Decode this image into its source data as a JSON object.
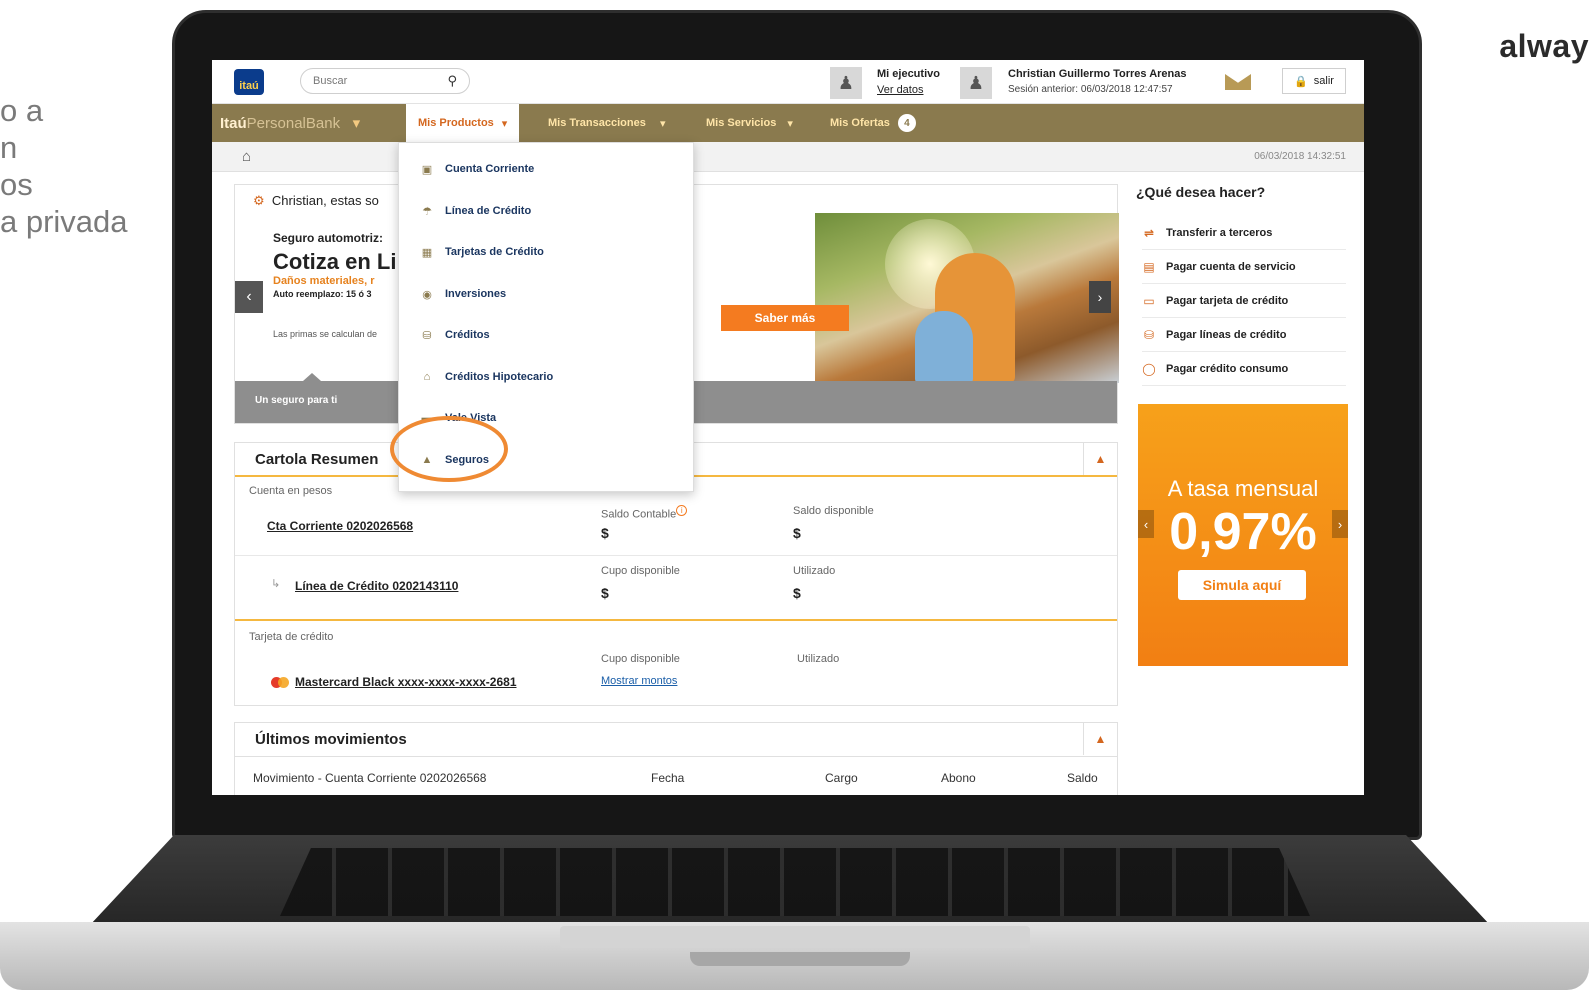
{
  "side_text": [
    "o a",
    "n",
    "os",
    "a privada"
  ],
  "brand_word": "alway",
  "topbar": {
    "logo": "itaú",
    "search_placeholder": "Buscar",
    "executive_label": "Mi ejecutivo",
    "executive_link": "Ver datos",
    "user_name": "Christian Guillermo Torres Arenas",
    "previous_session": "Sesión anterior: 06/03/2018 12:47:57",
    "logout_label": "salir"
  },
  "navbar": {
    "brand_bold": "Itaú",
    "brand_light": "PersonalBank",
    "items": {
      "productos": "Mis Productos",
      "transacciones": "Mis Transacciones",
      "servicios": "Mis Servicios",
      "ofertas": "Mis Ofertas",
      "ofertas_badge": "4"
    }
  },
  "breadcrumb": {
    "datetime": "06/03/2018 14:32:51"
  },
  "dropdown": {
    "items": [
      "Cuenta Corriente",
      "Línea de Crédito",
      "Tarjetas de Crédito",
      "Inversiones",
      "Créditos",
      "Créditos Hipotecario",
      "Vale Vista",
      "Seguros"
    ]
  },
  "banner": {
    "greeting": "Christian, estas so",
    "insurance_label": "Seguro automotriz:",
    "title": "Cotiza en Li",
    "subtitle": "Daños materiales, r",
    "replacement": "Auto reemplazo: 15 ó 3",
    "note": "Las primas se calculan de",
    "cta": "Saber más",
    "bottom_label": "Un seguro para ti"
  },
  "cartola": {
    "title": "Cartola Resumen",
    "pesos_label": "Cuenta en pesos",
    "account_link": "Cta Corriente 0202026568",
    "saldo_contable": "Saldo Contable",
    "saldo_disponible": "Saldo disponible",
    "currency": "$",
    "credit_line_link": "Línea de Crédito 0202143110",
    "cupo_disponible": "Cupo disponible",
    "utilizado": "Utilizado",
    "card_label": "Tarjeta de crédito",
    "card_link": "Mastercard Black xxxx-xxxx-xxxx-2681",
    "show_amounts": "Mostrar montos"
  },
  "movimientos": {
    "title": "Últimos movimientos",
    "columns": [
      "Movimiento - Cuenta Corriente 0202026568",
      "Fecha",
      "Cargo",
      "Abono",
      "Saldo"
    ]
  },
  "right": {
    "heading": "¿Qué desea hacer?",
    "actions": [
      "Transferir a terceros",
      "Pagar cuenta de servicio",
      "Pagar tarjeta de crédito",
      "Pagar líneas de crédito",
      "Pagar crédito consumo"
    ],
    "promo_title": "A tasa mensual",
    "promo_rate": "0,97%",
    "promo_cta": "Simula aquí"
  },
  "colors": {
    "nav_bg": "#8a7a4e",
    "accent_orange": "#f47b20",
    "ring": "#ef8a33"
  }
}
